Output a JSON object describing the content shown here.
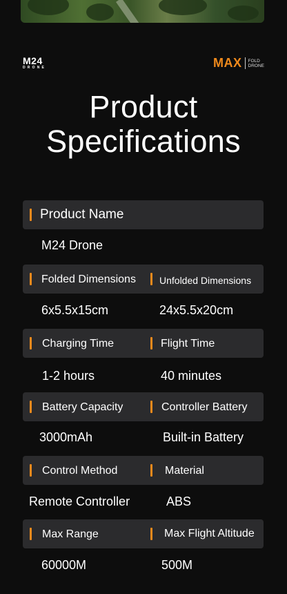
{
  "brand": {
    "left_logo": "M24",
    "left_sub": "DRONE",
    "right_logo": "MAX",
    "right_sub_1": "FOLD",
    "right_sub_2": "DRONE"
  },
  "title": {
    "line1": "Product",
    "line2": "Specifications"
  },
  "specs": [
    {
      "label": "Product Name",
      "value": "M24 Drone"
    },
    {
      "label": "Folded Dimensions",
      "value": "6x5.5x15cm"
    },
    {
      "label": "Unfolded Dimensions",
      "value": "24x5.5x20cm"
    },
    {
      "label": "Charging Time",
      "value": "1-2 hours"
    },
    {
      "label": "Flight Time",
      "value": "40 minutes"
    },
    {
      "label": "Battery Capacity",
      "value": "3000mAh"
    },
    {
      "label": "Controller Battery",
      "value": "Built-in Battery"
    },
    {
      "label": "Control Method",
      "value": "Remote Controller"
    },
    {
      "label": "Material",
      "value": "ABS"
    },
    {
      "label": "Max Range",
      "value": "60000M"
    },
    {
      "label": "Max Flight Altitude",
      "value": "500M"
    }
  ],
  "colors": {
    "accent": "#f08a1c",
    "background": "#0d0d0d",
    "bar": "#2b2b2d"
  }
}
